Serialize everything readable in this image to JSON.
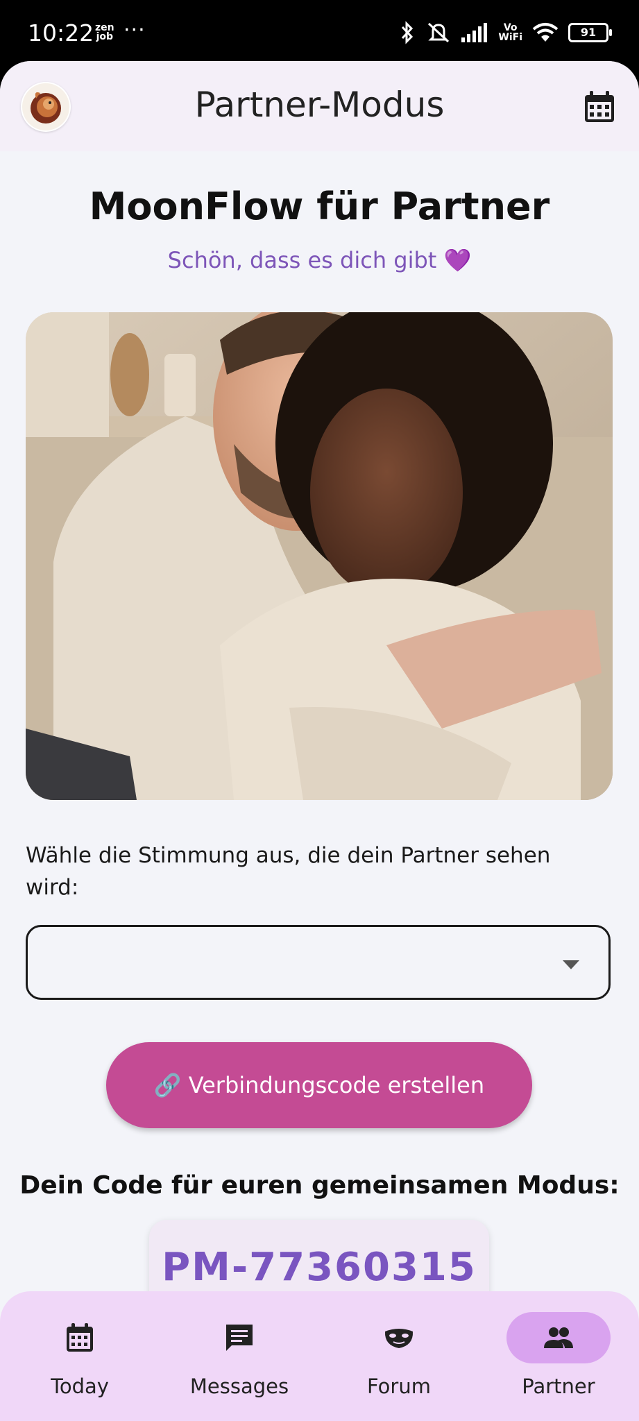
{
  "status_bar": {
    "time": "10:22",
    "zen_top": "zen",
    "zen_bottom": "job",
    "dots": "···",
    "vo": "Vo",
    "wifi_label": "WiFi",
    "battery": "91"
  },
  "header": {
    "title": "Partner-Modus",
    "avatar_icon": "squirrel-avatar",
    "calendar_icon": "calendar-icon"
  },
  "main": {
    "title": "MoonFlow für Partner",
    "subtitle": "Schön, dass es dich gibt 💜",
    "hero_image": "couple-embracing-photo",
    "mood_prompt": "Wähle die Stimmung aus, die dein Partner sehen wird:",
    "mood_select_value": "",
    "create_button": {
      "icon": "🔗",
      "label": "Verbindungscode erstellen"
    },
    "code_heading": "Dein Code für euren gemeinsamen Modus:",
    "code_value": "PM-77360315"
  },
  "bottom_nav": {
    "items": [
      {
        "label": "Today",
        "icon": "calendar-icon",
        "active": false
      },
      {
        "label": "Messages",
        "icon": "message-icon",
        "active": false
      },
      {
        "label": "Forum",
        "icon": "mask-icon",
        "active": false
      },
      {
        "label": "Partner",
        "icon": "people-icon",
        "active": true
      }
    ]
  },
  "colors": {
    "accent": "#c44b94",
    "subtitle": "#7d55b8",
    "code": "#7a55c0",
    "nav_bg": "#f0d7f8",
    "nav_active": "#d9a3ef"
  }
}
